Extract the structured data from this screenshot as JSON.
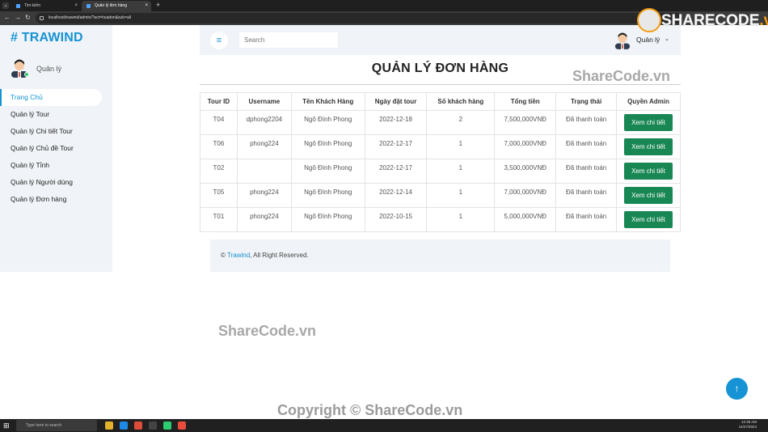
{
  "browser": {
    "tabs": [
      {
        "label": "Tim kiếm"
      },
      {
        "label": "Quản lý đơn hàng"
      }
    ],
    "new_tab": "+",
    "url": "localhost/trawind/admin/?act=hoadon&sub=all"
  },
  "sidebar": {
    "brand": "# TRAWIND",
    "profile_name": "Quản lý",
    "items": [
      {
        "label": "Trang Chủ",
        "active": true
      },
      {
        "label": "Quản lý Tour"
      },
      {
        "label": "Quản lý Chi tiết Tour"
      },
      {
        "label": "Quản lý Chủ đề Tour"
      },
      {
        "label": "Quản lý Tỉnh"
      },
      {
        "label": "Quản lý Người dùng"
      },
      {
        "label": "Quản lý Đơn hàng"
      }
    ]
  },
  "topbar": {
    "menu_icon": "≡",
    "search_placeholder": "Search",
    "user_name": "Quản lý",
    "caret": "⌄"
  },
  "main": {
    "title": "QUẢN LÝ ĐƠN HÀNG",
    "columns": [
      "Tour ID",
      "Username",
      "Tên Khách Hàng",
      "Ngày đặt tour",
      "Số khách hàng",
      "Tổng tiền",
      "Trạng thái",
      "Quyền Admin"
    ],
    "rows": [
      {
        "tour_id": "T04",
        "username": "dphong2204",
        "customer": "Ngô Đình Phong",
        "date": "2022-12-18",
        "guests": "2",
        "total": "7,500,000VNĐ",
        "status": "Đã thanh toán",
        "action": "Xem chi tiết"
      },
      {
        "tour_id": "T06",
        "username": "phong224",
        "customer": "Ngô Đình Phong",
        "date": "2022-12-17",
        "guests": "1",
        "total": "7,000,000VNĐ",
        "status": "Đã thanh toán",
        "action": "Xem chi tiết"
      },
      {
        "tour_id": "T02",
        "username": "",
        "customer": "Ngô Đình Phong",
        "date": "2022-12-17",
        "guests": "1",
        "total": "3,500,000VNĐ",
        "status": "Đã thanh toán",
        "action": "Xem chi tiết"
      },
      {
        "tour_id": "T05",
        "username": "phong224",
        "customer": "Ngô Đình Phong",
        "date": "2022-12-14",
        "guests": "1",
        "total": "7,000,000VNĐ",
        "status": "Đã thanh toán",
        "action": "Xem chi tiết"
      },
      {
        "tour_id": "T01",
        "username": "phong224",
        "customer": "Ngô Đình Phong",
        "date": "2022-10-15",
        "guests": "1",
        "total": "5,000,000VNĐ",
        "status": "Đã thanh toán",
        "action": "Xem chi tiết"
      }
    ]
  },
  "footer": {
    "copy": "©",
    "brand": "Trawind",
    "rest": ", All Right Reserved."
  },
  "watermarks": {
    "logo_share": "SHARECODE",
    "logo_vn": ".vn",
    "mid": "ShareCode.vn",
    "lower": "ShareCode.vn",
    "bottom": "Copyright © ShareCode.vn"
  },
  "scroll_top_icon": "↑",
  "taskbar": {
    "search": "Type here to search",
    "time": "12:36 AM",
    "date": "11/27/2024"
  },
  "colors": {
    "accent": "#1593d4",
    "success": "#198754",
    "sidebar_bg": "#f0f3f7"
  }
}
